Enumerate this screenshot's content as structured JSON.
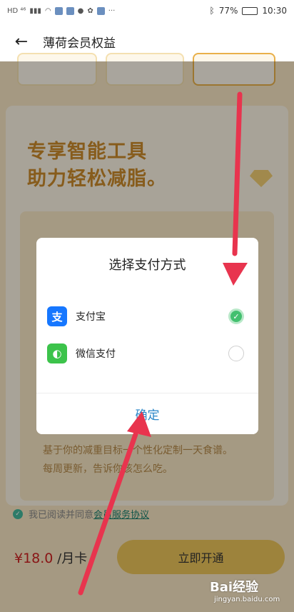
{
  "status_bar": {
    "left_text": "HD ⁴⁶",
    "battery": "77%",
    "time": "10:30"
  },
  "header": {
    "back_icon": "arrow-left-icon",
    "title": "薄荷会员权益"
  },
  "background": {
    "promo_title_line1": "专享智能工具",
    "promo_title_line2": "助力轻松减脂。",
    "description_line1": "基于你的减重目标一个性化定制一天食谱。",
    "description_line2": "每周更新，告诉你该怎么吃。"
  },
  "bottom": {
    "agree_text": "我已阅读并同意",
    "agree_link": "会员服务协议",
    "price": "¥18.0",
    "price_unit": " /月卡",
    "buy_button": "立即开通"
  },
  "modal": {
    "title": "选择支付方式",
    "options": [
      {
        "icon": "alipay-icon",
        "label": "支付宝",
        "selected": true
      },
      {
        "icon": "wechat-pay-icon",
        "label": "微信支付",
        "selected": false
      }
    ],
    "confirm": "确定"
  },
  "annotation_color": "#e8344e",
  "watermark": {
    "brand": "Bai经验",
    "url": "jingyan.baidu.com"
  }
}
